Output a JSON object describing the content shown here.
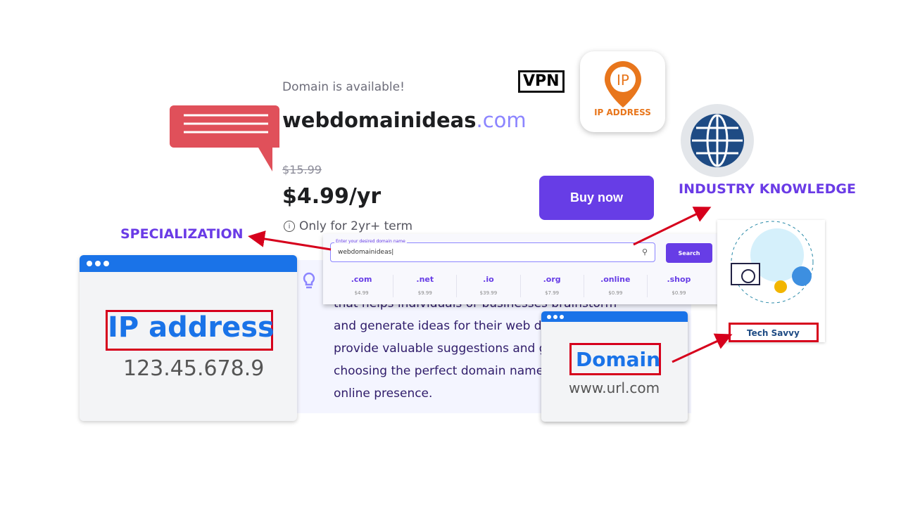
{
  "availability": "Domain is available!",
  "domain": {
    "name": "webdomainideas",
    "tld": ".com"
  },
  "price": {
    "original": "$15.99",
    "current": "$4.99/yr",
    "term": "Only for 2yr+ term"
  },
  "buy_label": "Buy now",
  "search": {
    "label": "Enter your desired domain name",
    "value": "webdomainideas",
    "button": "Search"
  },
  "tlds": [
    {
      "tld": ".com",
      "price": "$4.99"
    },
    {
      "tld": ".net",
      "price": "$9.99"
    },
    {
      "tld": ".io",
      "price": "$39.99"
    },
    {
      "tld": ".org",
      "price": "$7.99"
    },
    {
      "tld": ".online",
      "price": "$0.99"
    },
    {
      "tld": ".shop",
      "price": "$0.99"
    }
  ],
  "description": {
    "lines": [
      "that helps individuals or businesses brainstorm",
      "and generate ideas for their web d",
      "provide valuable suggestions and g",
      "choosing the perfect domain name",
      "online presence."
    ]
  },
  "ip_card": {
    "title": "IP address",
    "value": "123.45.678.9"
  },
  "domain_card": {
    "title": "Domain",
    "value": "www.url.com"
  },
  "labels": {
    "specialization": "SPECIALIZATION",
    "industry": "INDUSTRY KNOWLEDGE",
    "tech": "Tech Savvy"
  },
  "vpn": "VPN",
  "ip_app": "IP ADDRESS",
  "colors": {
    "accent": "#673de6",
    "blue": "#1a73e8",
    "red": "#d6001c"
  }
}
